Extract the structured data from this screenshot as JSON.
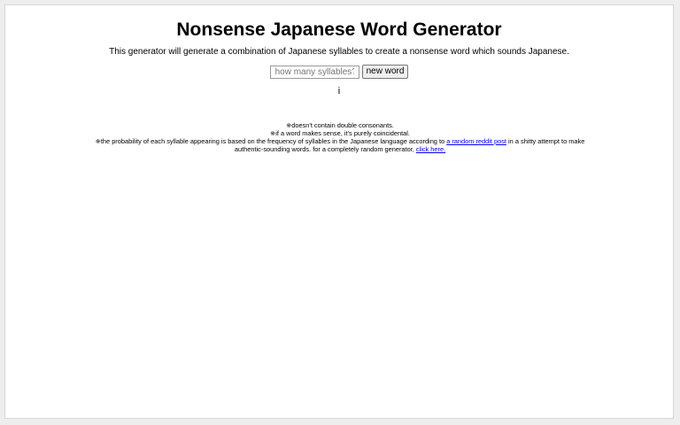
{
  "page": {
    "title": "Nonsense Japanese Word Generator",
    "intro": "This generator will generate a combination of Japanese syllables to create a nonsense word which sounds Japanese."
  },
  "controls": {
    "syllables_placeholder": "how many syllables?",
    "syllables_value": "",
    "new_word_label": "new word"
  },
  "result": {
    "word": "i"
  },
  "notes": {
    "note1": "※doesn't contain double consonants.",
    "note2": "※if a word makes sense, it's purely coincidental.",
    "note3_before": "※the probability of each syllable appearing is based on the frequency of syllables in the Japanese language according to ",
    "note3_link": "a random reddit post",
    "note3_middle": " in a shitty attempt to make authentic-sounding words. for a completely random generator, ",
    "note3_link2": "click here."
  },
  "colors": {
    "link": "#0000ee",
    "background": "#ffffff",
    "outer_background": "#eeeeee"
  }
}
